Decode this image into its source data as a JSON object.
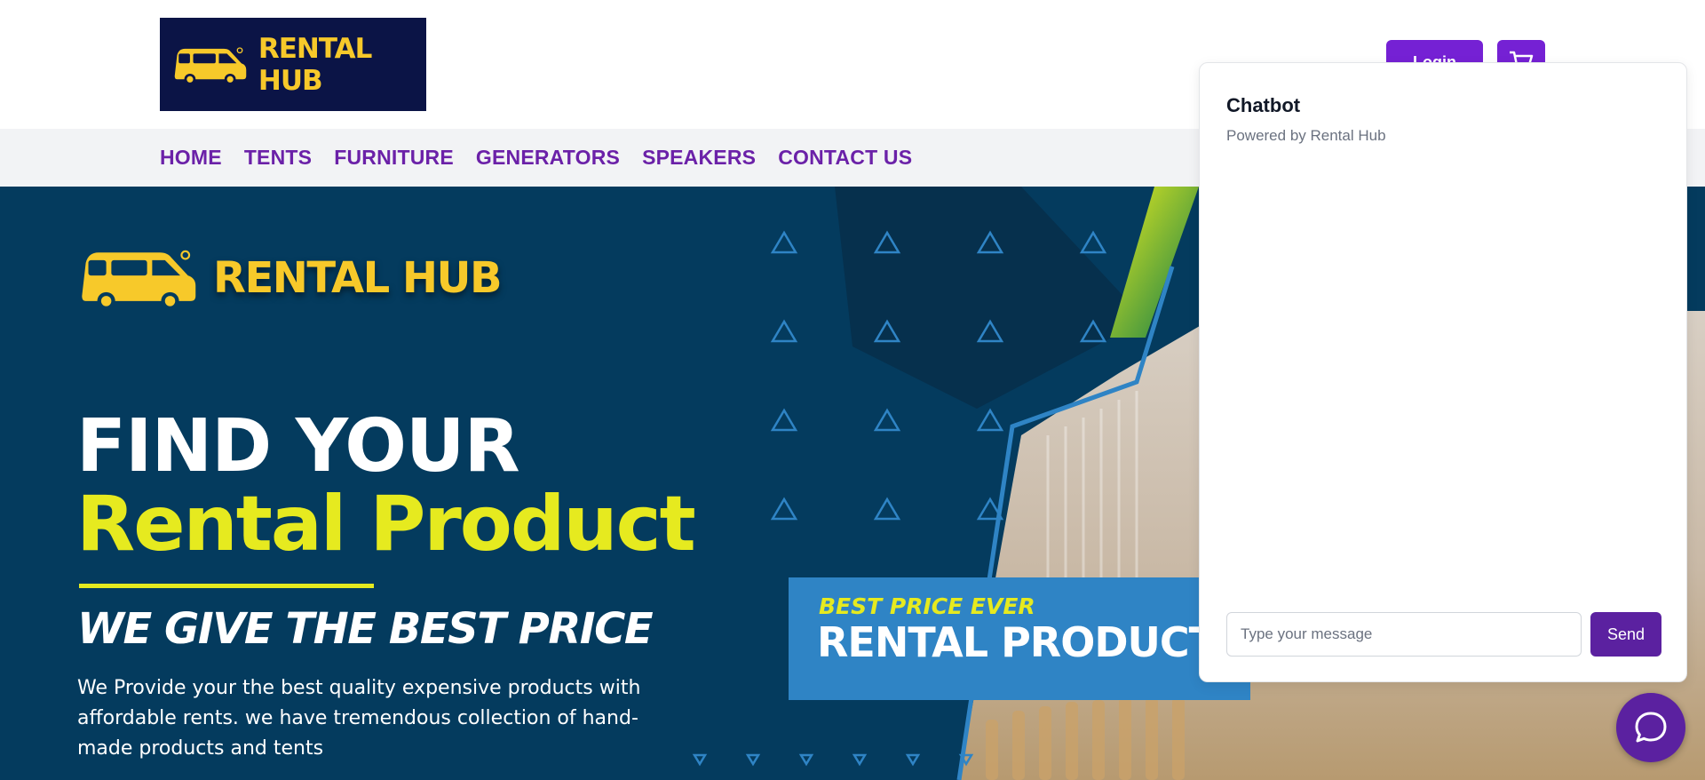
{
  "header": {
    "logo_text": "RENTAL HUB",
    "login_label": "Login",
    "cart_icon": "cart-icon"
  },
  "nav": {
    "items": [
      {
        "label": "HOME"
      },
      {
        "label": "TENTS"
      },
      {
        "label": "FURNITURE"
      },
      {
        "label": "GENERATORS"
      },
      {
        "label": "SPEAKERS"
      },
      {
        "label": "CONTACT US"
      }
    ]
  },
  "hero": {
    "logo_text": "RENTAL HUB",
    "title_line1": "FIND YOUR",
    "title_line2": "Rental Product",
    "tagline": "WE GIVE THE BEST PRICE",
    "description": "We Provide your the best quality expensive products with affordable rents. we have tremendous collection of hand-made products and tents",
    "promo_small": "BEST PRICE EVER",
    "promo_big": "RENTAL PRODUCTS"
  },
  "chat": {
    "title": "Chatbot",
    "subtitle": "Powered by Rental Hub",
    "input_placeholder": "Type your message",
    "input_value": "",
    "send_label": "Send",
    "fab_icon": "chat-bubble-icon"
  },
  "colors": {
    "brand_purple": "#7521d4",
    "nav_text": "#6b21a8",
    "hero_bg": "#043b5e",
    "accent_yellow": "#e6ea1f",
    "logo_bg": "#0b1446",
    "logo_yellow": "#f7c92a"
  }
}
